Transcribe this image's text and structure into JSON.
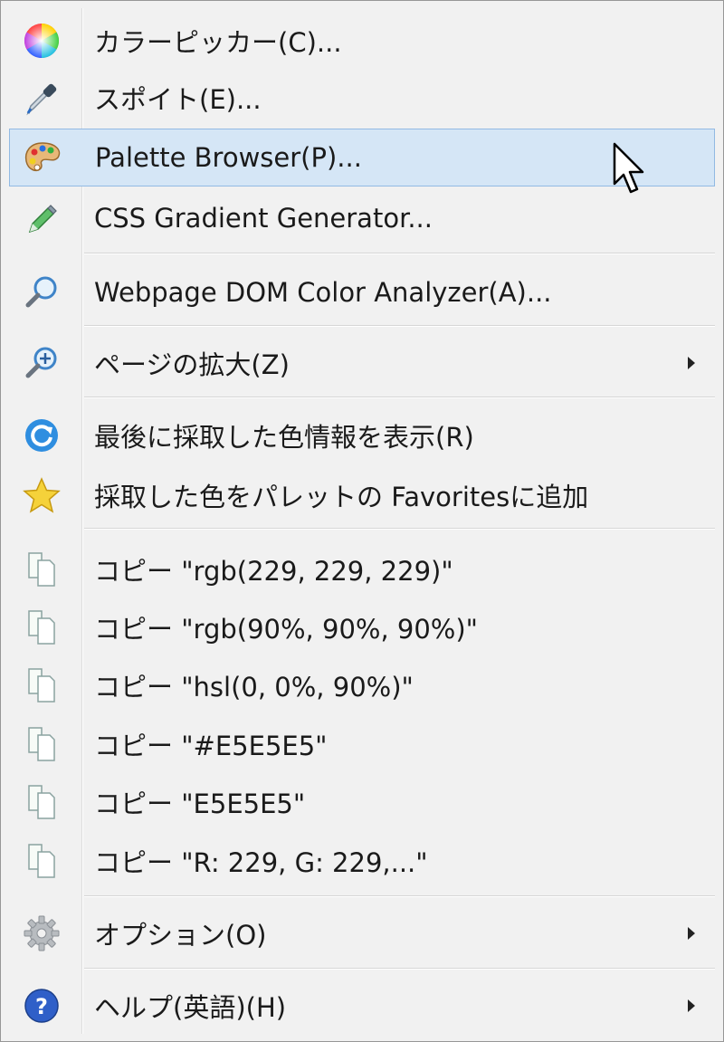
{
  "menu": {
    "items": [
      {
        "label": "カラーピッカー(C)...",
        "icon": "color-wheel-icon"
      },
      {
        "label": "スポイト(E)...",
        "icon": "eyedropper-icon"
      },
      {
        "label": "Palette Browser(P)...",
        "icon": "palette-icon",
        "highlighted": true
      },
      {
        "label": "CSS Gradient Generator...",
        "icon": "gradient-pen-icon"
      },
      {
        "label": "Webpage DOM Color Analyzer(A)...",
        "icon": "magnifier-icon"
      },
      {
        "label": "ページの拡大(Z)",
        "icon": "zoom-in-icon",
        "submenu": true
      },
      {
        "label": "最後に採取した色情報を表示(R)",
        "icon": "refresh-icon"
      },
      {
        "label": "採取した色をパレットの Favoritesに追加",
        "icon": "star-icon"
      },
      {
        "label": "コピー \"rgb(229, 229, 229)\"",
        "icon": "copy-icon"
      },
      {
        "label": "コピー \"rgb(90%, 90%, 90%)\"",
        "icon": "copy-icon"
      },
      {
        "label": "コピー \"hsl(0, 0%, 90%)\"",
        "icon": "copy-icon"
      },
      {
        "label": "コピー \"#E5E5E5\"",
        "icon": "copy-icon"
      },
      {
        "label": "コピー \"E5E5E5\"",
        "icon": "copy-icon"
      },
      {
        "label": "コピー \"R: 229, G: 229,...\"",
        "icon": "copy-icon"
      },
      {
        "label": "オプション(O)",
        "icon": "gear-icon",
        "submenu": true
      },
      {
        "label": "ヘルプ(英語)(H)",
        "icon": "help-icon",
        "submenu": true
      }
    ]
  },
  "colors": {
    "menu_background": "#f1f1f1",
    "highlight_background": "#d5e6f6",
    "highlight_border": "#92b9e3",
    "text": "#1a1a1a"
  }
}
